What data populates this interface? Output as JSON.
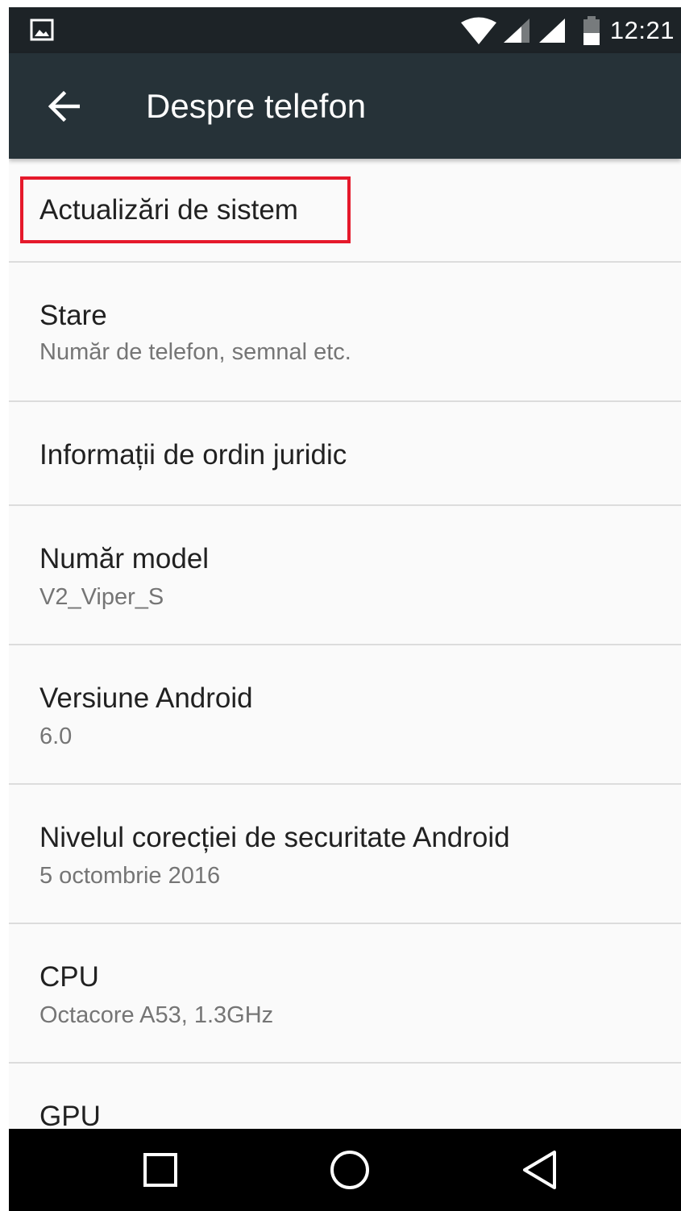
{
  "status_bar": {
    "time": "12:21",
    "icons": [
      "image-notification-icon",
      "wifi-icon",
      "signal-icon",
      "signal-icon",
      "battery-icon"
    ]
  },
  "app_bar": {
    "title": "Despre telefon",
    "back_icon": "arrow-back-icon"
  },
  "items": [
    {
      "title": "Actualizări de sistem",
      "summary": "",
      "highlighted": true
    },
    {
      "title": "Stare",
      "summary": "Număr de telefon, semnal etc."
    },
    {
      "title": "Informații de ordin juridic",
      "summary": ""
    },
    {
      "title": "Număr model",
      "summary": "V2_Viper_S"
    },
    {
      "title": "Versiune Android",
      "summary": "6.0"
    },
    {
      "title": "Nivelul corecției de securitate Android",
      "summary": "5 octombrie 2016"
    },
    {
      "title": "CPU",
      "summary": "Octacore A53, 1.3GHz"
    },
    {
      "title": "GPU",
      "summary": ""
    }
  ],
  "nav_bar": {
    "buttons": [
      "recents-icon",
      "home-icon",
      "back-icon"
    ]
  },
  "colors": {
    "status_bar": "#1d2327",
    "app_bar": "#263238",
    "background": "#fafafa",
    "highlight": "#e5192b"
  }
}
